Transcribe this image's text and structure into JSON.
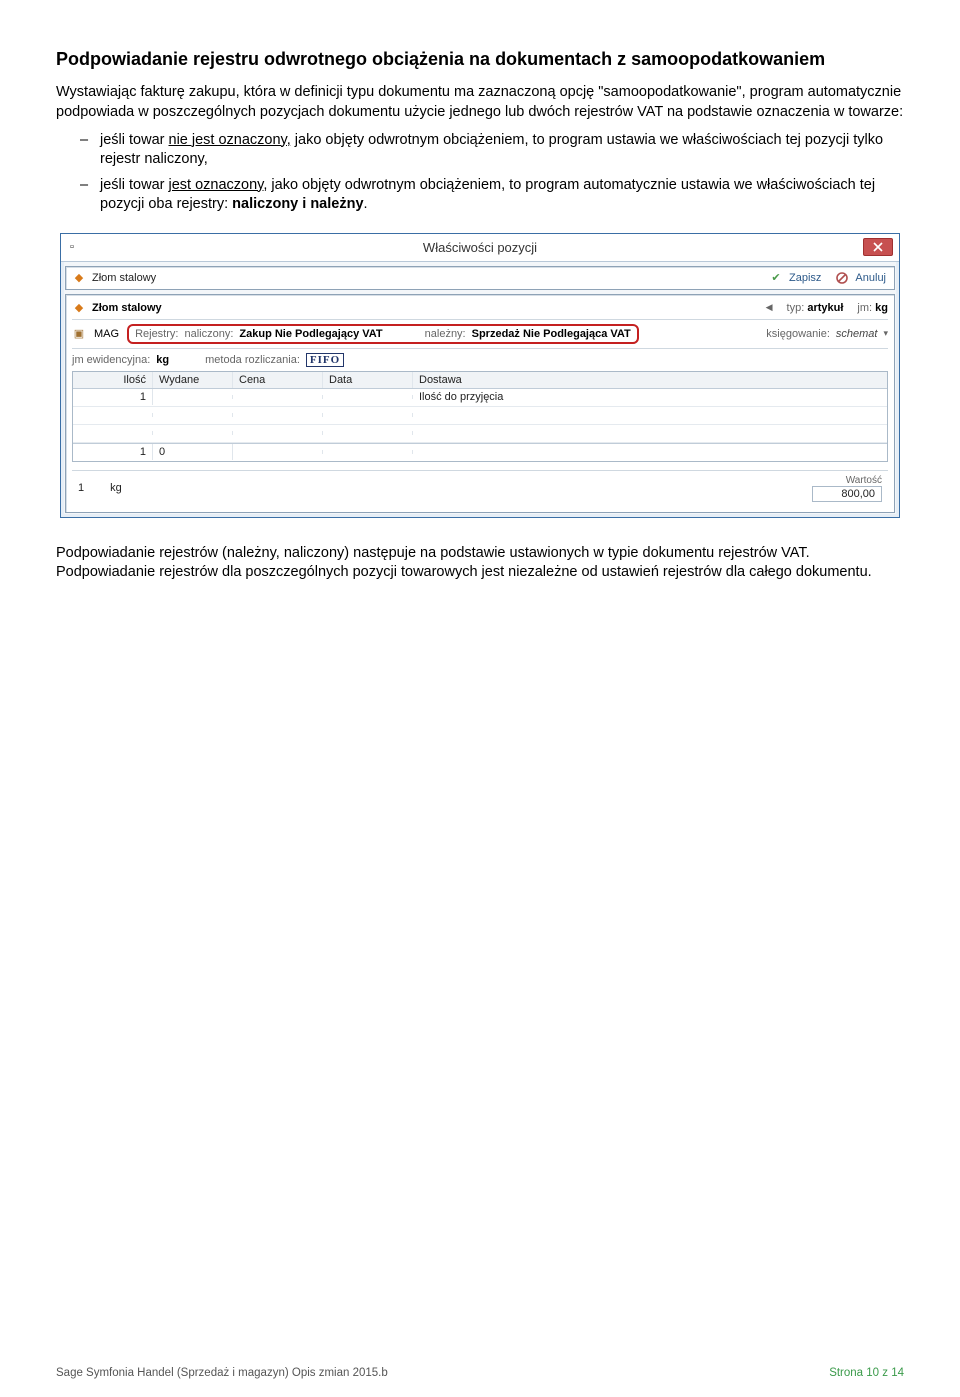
{
  "doc": {
    "heading": "Podpowiadanie rejestru odwrotnego obciążenia na dokumentach z samoopodatkowaniem",
    "intro": "Wystawiając fakturę zakupu, która w definicji typu dokumentu ma zaznaczoną opcję \"samoopodatkowanie\", program automatycznie podpowiada w poszczególnych pozycjach dokumentu użycie jednego lub dwóch rejestrów VAT na podstawie oznaczenia w towarze:",
    "bullets": [
      {
        "pre": "jeśli towar ",
        "ul": "nie jest oznaczony,",
        "post": " jako objęty odwrotnym obciążeniem, to program ustawia we właściwościach tej pozycji tylko rejestr naliczony,"
      },
      {
        "pre": "jeśli towar ",
        "ul": "jest oznaczony,",
        "post": " jako objęty odwrotnym obciążeniem, to program automatycznie ustawia we właściwościach tej pozycji oba rejestry: ",
        "bold": "naliczony i należny",
        "tail": "."
      }
    ],
    "closing": "Podpowiadanie rejestrów (należny, naliczony) następuje na podstawie ustawionych w typie dokumentu rejestrów VAT. Podpowiadanie rejestrów dla poszczególnych pozycji towarowych jest niezależne od ustawień rejestrów dla całego dokumentu."
  },
  "dlg": {
    "title": "Właściwości pozycji",
    "product_name": "Złom stalowy",
    "btn_save": "Zapisz",
    "btn_cancel": "Anuluj",
    "lbl_typ": "typ:",
    "val_typ": "artykuł",
    "lbl_jm": "jm:",
    "val_jm": "kg",
    "mag": "MAG",
    "lbl_rejestry": "Rejestry:",
    "lbl_naliczony": "naliczony:",
    "val_naliczony": "Zakup Nie Podlegający VAT",
    "lbl_nalezny": "należny:",
    "val_nalezny": "Sprzedaż Nie Podlegająca VAT",
    "lbl_ksiegowanie": "księgowanie:",
    "val_ksiegowanie": "schemat",
    "lbl_jmewid": "jm ewidencyjna:",
    "val_jmewid": "kg",
    "lbl_metoda": "metoda rozliczania:",
    "val_metoda": "FIFO",
    "grid": {
      "cols": [
        "Ilość",
        "Wydane",
        "Cena",
        "Data",
        "Dostawa"
      ],
      "rows": [
        [
          "1",
          "",
          "",
          "",
          "Ilość do przyjęcia"
        ]
      ],
      "sum": [
        "1",
        "0"
      ]
    },
    "summary": {
      "qty": "1",
      "jm": "kg",
      "lbl_wartosc": "Wartość",
      "wartosc": "800,00"
    }
  },
  "footer": {
    "left": "Sage Symfonia Handel (Sprzedaż i magazyn) Opis zmian 2015.b",
    "right": "Strona 10 z 14"
  }
}
